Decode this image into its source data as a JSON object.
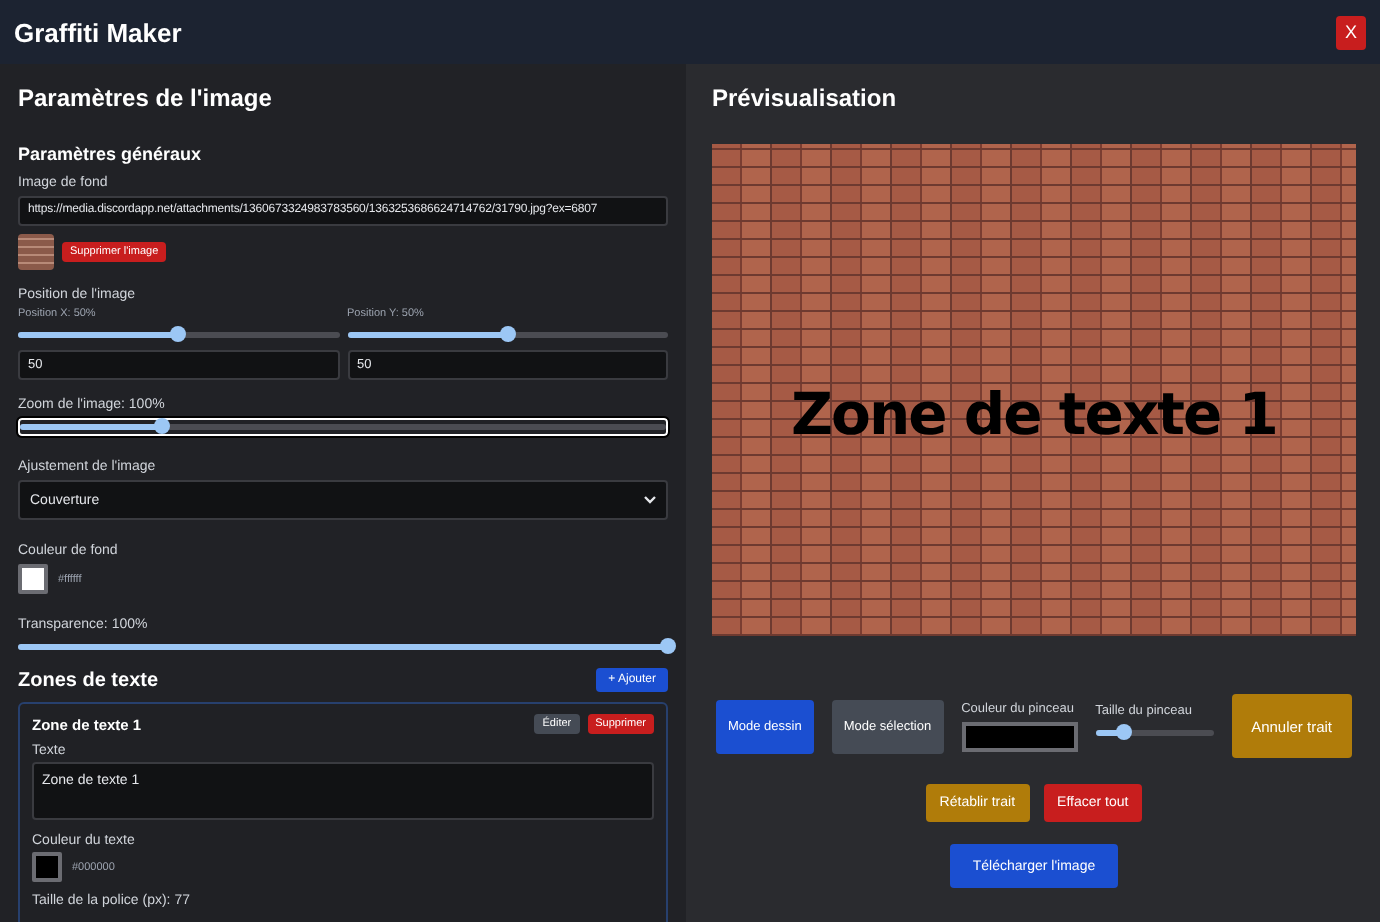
{
  "window": {
    "title": "Graffiti Maker",
    "close": "X"
  },
  "settings": {
    "title": "Paramètres de l'image",
    "general_title": "Paramètres généraux",
    "background_image": {
      "label": "Image de fond",
      "value": "https://media.discordapp.net/attachments/1360673324983783560/1363253686624714762/31790.jpg?ex=6807",
      "remove_button": "Supprimer l'image"
    },
    "position": {
      "label": "Position de l'image",
      "x": {
        "label": "Position X: 50%",
        "level": 0.5,
        "value": "50"
      },
      "y": {
        "label": "Position Y: 50%",
        "level": 0.5,
        "value": "50"
      }
    },
    "zoom": {
      "label": "Zoom de l'image: 100%",
      "level": 0.22,
      "focused": true
    },
    "fit": {
      "label": "Ajustement de l'image",
      "value": "Couverture"
    },
    "background_color": {
      "label": "Couleur de fond",
      "color": "#ffffff",
      "value": "#ffffff"
    },
    "transparency": {
      "label": "Transparence: 100%",
      "level": 1.0
    }
  },
  "text_zones": {
    "title": "Zones de texte",
    "add_button": "+ Ajouter",
    "zones": [
      {
        "title": "Zone de texte 1",
        "edit_button": "Éditer",
        "delete_button": "Supprimer",
        "text_label": "Texte",
        "text": "Zone de texte 1",
        "color_label": "Couleur du texte",
        "color": "#000000",
        "color_value": "#000000",
        "size_label": "Taille de la police (px): 77"
      }
    ]
  },
  "preview": {
    "title": "Prévisualisation",
    "canvas_text": "Zone de texte 1",
    "modes": [
      {
        "label": "Mode dessin",
        "selected": true
      },
      {
        "label": "Mode sélection",
        "selected": false
      }
    ],
    "brush_color": {
      "label": "Couleur du pinceau",
      "color": "#000000"
    },
    "brush_size": {
      "label": "Taille du pinceau",
      "level": 0.25
    },
    "actions": [
      {
        "label": "Annuler trait",
        "kind": "warning"
      },
      {
        "label": "Rétablir trait",
        "kind": "warning"
      },
      {
        "label": "Effacer tout",
        "kind": "danger"
      },
      {
        "label": "Télécharger l'image",
        "kind": "primary"
      }
    ]
  }
}
